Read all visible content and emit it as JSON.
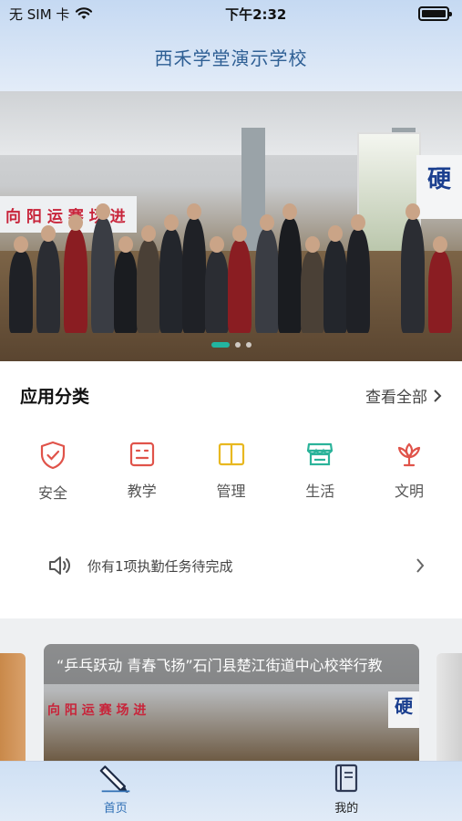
{
  "status_bar": {
    "carrier": "无 SIM 卡",
    "time": "下午2:32"
  },
  "header": {
    "title": "西禾学堂演示学校"
  },
  "banner": {
    "wall_text": "向 阳 运 赛 场 进",
    "sign_text": "硬",
    "slides": 3,
    "active_slide": 1
  },
  "categories_section": {
    "title": "应用分类",
    "view_all": "查看全部",
    "items": [
      {
        "label": "安全",
        "icon": "shield-check-icon",
        "color": "#e0534a"
      },
      {
        "label": "教学",
        "icon": "teaching-board-icon",
        "color": "#e0534a"
      },
      {
        "label": "管理",
        "icon": "book-open-icon",
        "color": "#e8b820"
      },
      {
        "label": "生活",
        "icon": "store-icon",
        "color": "#2bb39a"
      },
      {
        "label": "文明",
        "icon": "lotus-icon",
        "color": "#e0534a"
      }
    ]
  },
  "notice": {
    "text": "你有1项执勤任务待完成"
  },
  "news": {
    "title": "“乒乓跃动 青春飞扬”石门县楚江街道中心校举行教",
    "wall_text": "向 阳 运 赛 场 进",
    "sign_text": "硬"
  },
  "tabbar": {
    "tabs": [
      {
        "label": "首页",
        "active": true
      },
      {
        "label": "我的",
        "active": false
      }
    ]
  },
  "colors": {
    "accent": "#2f6fb5",
    "title": "#2e5f94",
    "dot_active": "#22b5a0"
  }
}
